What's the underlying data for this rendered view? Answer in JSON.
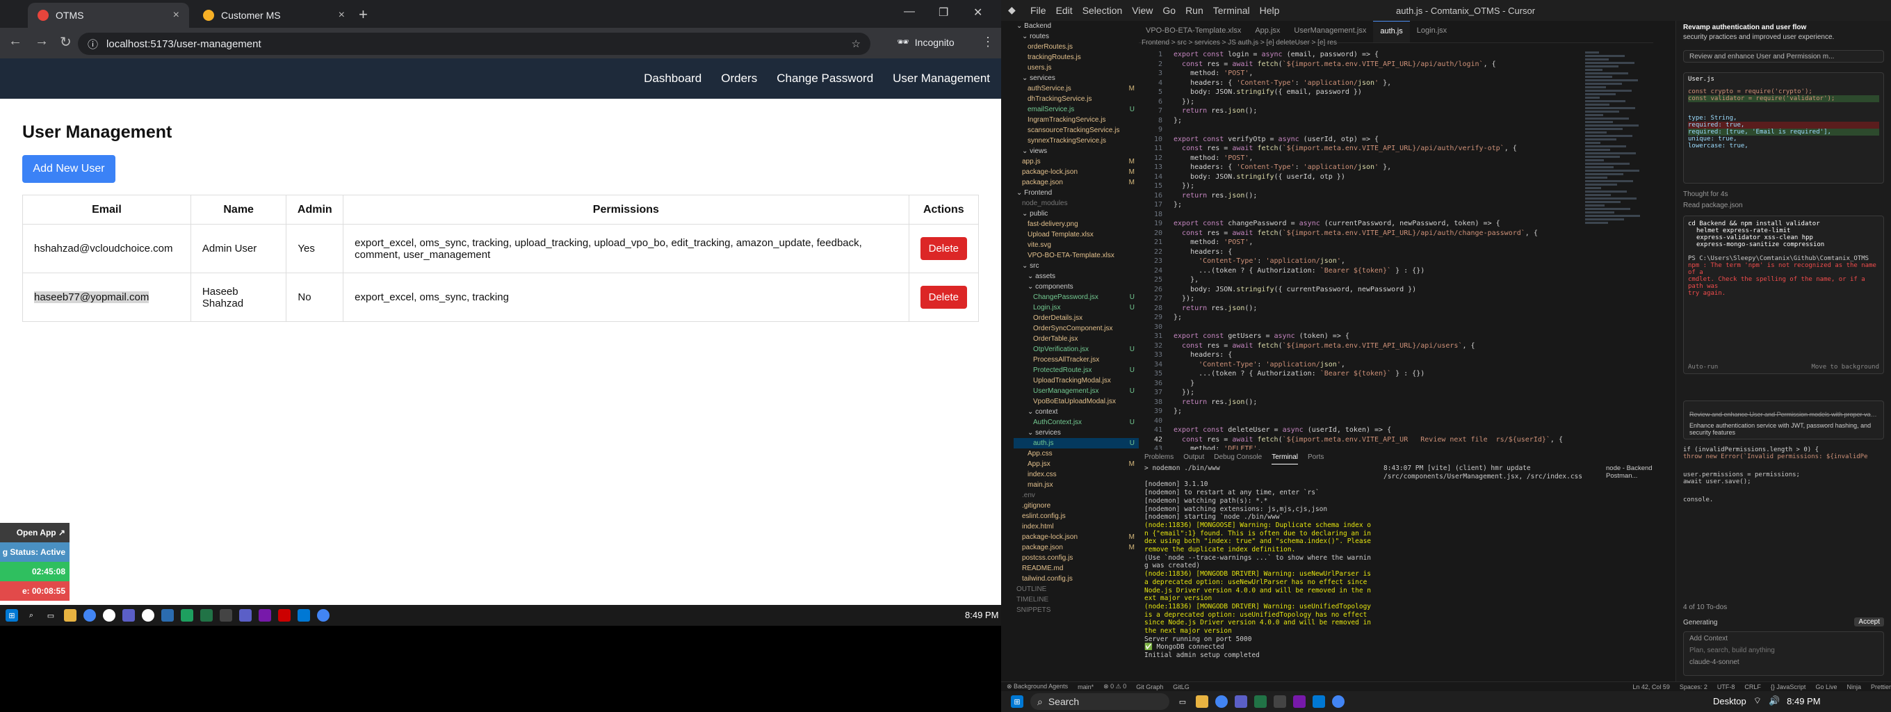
{
  "browser": {
    "tabs": [
      {
        "title": "OTMS",
        "favicon_color": "#e8453c"
      },
      {
        "title": "Customer MS",
        "favicon_color": "#f6b026"
      }
    ],
    "url": "localhost:5173/user-management",
    "incognito_label": "Incognito"
  },
  "app": {
    "nav": [
      "Dashboard",
      "Orders",
      "Change Password",
      "User Management"
    ],
    "heading": "User Management",
    "add_button": "Add New User",
    "columns": [
      "Email",
      "Name",
      "Admin",
      "Permissions",
      "Actions"
    ],
    "rows": [
      {
        "email": "hshahzad@vcloudchoice.com",
        "name": "Admin User",
        "admin": "Yes",
        "permissions": "export_excel, oms_sync, tracking, upload_tracking, upload_vpo_bo, edit_tracking, amazon_update, feedback, comment, user_management",
        "action": "Delete"
      },
      {
        "email": "haseeb77@yopmail.com",
        "name": "Haseeb Shahzad",
        "admin": "No",
        "permissions": "export_excel, oms_sync, tracking",
        "action": "Delete"
      }
    ]
  },
  "widget": {
    "open_app": "Open App ↗",
    "status": "g Status: Active",
    "time1": "02:45:08",
    "time2": "e: 00:08:55"
  },
  "taskbar_left": {
    "time": "8:49 PM"
  },
  "ide": {
    "title": "auth.js - Comtanix_OTMS - Cursor",
    "menu": [
      "File",
      "Edit",
      "Selection",
      "View",
      "Go",
      "Run",
      "Terminal",
      "Help"
    ],
    "tabs": [
      "VPO-BO-ETA-Template.xlsx",
      "App.jsx",
      "UserManagement.jsx",
      "auth.js",
      "Login.jsx"
    ],
    "breadcrumb": "Frontend > src > services > JS auth.js > [e] deleteUser > [e] res",
    "explorer": [
      {
        "t": "Backend",
        "c": "folder",
        "i": 0
      },
      {
        "t": "routes",
        "c": "folder",
        "i": 1
      },
      {
        "t": "orderRoutes.js",
        "c": "yel",
        "i": 2
      },
      {
        "t": "trackingRoutes.js",
        "c": "yel",
        "i": 2
      },
      {
        "t": "users.js",
        "c": "yel",
        "i": 2
      },
      {
        "t": "services",
        "c": "folder",
        "i": 1
      },
      {
        "t": "authService.js",
        "c": "yel",
        "i": 2,
        "b": "M"
      },
      {
        "t": "dhTrackingService.js",
        "c": "yel",
        "i": 2
      },
      {
        "t": "emailService.js",
        "c": "green",
        "i": 2,
        "b": "U"
      },
      {
        "t": "IngramTrackingService.js",
        "c": "yel",
        "i": 2
      },
      {
        "t": "scansourceTrackingService.js",
        "c": "yel",
        "i": 2
      },
      {
        "t": "synnexTrackingService.js",
        "c": "yel",
        "i": 2
      },
      {
        "t": "views",
        "c": "folder",
        "i": 1
      },
      {
        "t": "app.js",
        "c": "yel",
        "i": 1,
        "b": "M"
      },
      {
        "t": "package-lock.json",
        "c": "yel",
        "i": 1,
        "b": "M"
      },
      {
        "t": "package.json",
        "c": "yel",
        "i": 1,
        "b": "M"
      },
      {
        "t": "Frontend",
        "c": "folder",
        "i": 0
      },
      {
        "t": "node_modules",
        "c": "gray",
        "i": 1
      },
      {
        "t": "public",
        "c": "folder",
        "i": 1
      },
      {
        "t": "fast-delivery.png",
        "c": "yel",
        "i": 2
      },
      {
        "t": "Upload Template.xlsx",
        "c": "yel",
        "i": 2
      },
      {
        "t": "vite.svg",
        "c": "yel",
        "i": 2
      },
      {
        "t": "VPO-BO-ETA-Template.xlsx",
        "c": "yel",
        "i": 2
      },
      {
        "t": "src",
        "c": "folder",
        "i": 1
      },
      {
        "t": "assets",
        "c": "folder",
        "i": 2
      },
      {
        "t": "components",
        "c": "folder",
        "i": 2
      },
      {
        "t": "ChangePassword.jsx",
        "c": "green",
        "i": 3,
        "b": "U"
      },
      {
        "t": "Login.jsx",
        "c": "green",
        "i": 3,
        "b": "U"
      },
      {
        "t": "OrderDetails.jsx",
        "c": "yel",
        "i": 3
      },
      {
        "t": "OrderSyncComponent.jsx",
        "c": "yel",
        "i": 3
      },
      {
        "t": "OrderTable.jsx",
        "c": "yel",
        "i": 3
      },
      {
        "t": "OtpVerification.jsx",
        "c": "green",
        "i": 3,
        "b": "U"
      },
      {
        "t": "ProcessAllTracker.jsx",
        "c": "yel",
        "i": 3
      },
      {
        "t": "ProtectedRoute.jsx",
        "c": "green",
        "i": 3,
        "b": "U"
      },
      {
        "t": "UploadTrackingModal.jsx",
        "c": "yel",
        "i": 3
      },
      {
        "t": "UserManagement.jsx",
        "c": "green",
        "i": 3,
        "b": "U"
      },
      {
        "t": "VpoBoEtaUploadModal.jsx",
        "c": "yel",
        "i": 3
      },
      {
        "t": "context",
        "c": "folder",
        "i": 2
      },
      {
        "t": "AuthContext.jsx",
        "c": "green",
        "i": 3,
        "b": "U"
      },
      {
        "t": "services",
        "c": "folder",
        "i": 2
      },
      {
        "t": "auth.js",
        "c": "green",
        "i": 3,
        "b": "U",
        "sel": true
      },
      {
        "t": "App.css",
        "c": "yel",
        "i": 2
      },
      {
        "t": "App.jsx",
        "c": "yel",
        "i": 2,
        "b": "M"
      },
      {
        "t": "index.css",
        "c": "yel",
        "i": 2
      },
      {
        "t": "main.jsx",
        "c": "yel",
        "i": 2
      },
      {
        "t": ".env",
        "c": "gray",
        "i": 1
      },
      {
        "t": ".gitignore",
        "c": "yel",
        "i": 1
      },
      {
        "t": "eslint.config.js",
        "c": "yel",
        "i": 1
      },
      {
        "t": "index.html",
        "c": "yel",
        "i": 1
      },
      {
        "t": "package-lock.json",
        "c": "yel",
        "i": 1,
        "b": "M"
      },
      {
        "t": "package.json",
        "c": "yel",
        "i": 1,
        "b": "M"
      },
      {
        "t": "postcss.config.js",
        "c": "yel",
        "i": 1
      },
      {
        "t": "README.md",
        "c": "yel",
        "i": 1
      },
      {
        "t": "tailwind.config.js",
        "c": "yel",
        "i": 1
      },
      {
        "t": "OUTLINE",
        "c": "gray",
        "i": 0
      },
      {
        "t": "TIMELINE",
        "c": "gray",
        "i": 0
      },
      {
        "t": "SNIPPETS",
        "c": "gray",
        "i": 0
      }
    ],
    "code": [
      "export const login = async (email, password) => {",
      "  const res = await fetch(`${import.meta.env.VITE_API_URL}/api/auth/login`, {",
      "    method: 'POST',",
      "    headers: { 'Content-Type': 'application/json' },",
      "    body: JSON.stringify({ email, password })",
      "  });",
      "  return res.json();",
      "};",
      "",
      "export const verifyOtp = async (userId, otp) => {",
      "  const res = await fetch(`${import.meta.env.VITE_API_URL}/api/auth/verify-otp`, {",
      "    method: 'POST',",
      "    headers: { 'Content-Type': 'application/json' },",
      "    body: JSON.stringify({ userId, otp })",
      "  });",
      "  return res.json();",
      "};",
      "",
      "export const changePassword = async (currentPassword, newPassword, token) => {",
      "  const res = await fetch(`${import.meta.env.VITE_API_URL}/api/auth/change-password`, {",
      "    method: 'POST',",
      "    headers: {",
      "      'Content-Type': 'application/json',",
      "      ...(token ? { Authorization: `Bearer ${token}` } : {})",
      "    },",
      "    body: JSON.stringify({ currentPassword, newPassword })",
      "  });",
      "  return res.json();",
      "};",
      "",
      "export const getUsers = async (token) => {",
      "  const res = await fetch(`${import.meta.env.VITE_API_URL}/api/users`, {",
      "    headers: {",
      "      'Content-Type': 'application/json',",
      "      ...(token ? { Authorization: `Bearer ${token}` } : {})",
      "    }",
      "  });",
      "  return res.json();",
      "};",
      "",
      "export const deleteUser = async (userId, token) => {",
      "  const res = await fetch(`${import.meta.env.VITE_API_UR   Review next file  rs/${userId}`, {",
      "    method: 'DELETE',",
      "    headers: {"
    ],
    "panel_tabs": [
      "Problems",
      "Output",
      "Debug Console",
      "Terminal",
      "Ports"
    ],
    "terminal": [
      "> nodemon ./bin/www",
      "",
      "[nodemon] 3.1.10",
      "[nodemon] to restart at any time, enter `rs`",
      "[nodemon] watching path(s): *.*",
      "[nodemon] watching extensions: js,mjs,cjs,json",
      "[nodemon] starting `node ./bin/www`",
      "(node:11836) [MONGOOSE] Warning: Duplicate schema index on {\"email\":1} found. This is often due to declaring an index using both \"index: true\" and \"schema.index()\". Please remove the duplicate index definition.",
      "(Use `node --trace-warnings ...` to show where the warning was created)",
      "(node:11836) [MONGODB DRIVER] Warning: useNewUrlParser is a deprecated option: useNewUrlParser has no effect since Node.js Driver version 4.0.0 and will be removed in the next major version",
      "(node:11836) [MONGODB DRIVER] Warning: useUnifiedTopology is a deprecated option: useUnifiedTopology has no effect since Node.js Driver version 4.0.0 and will be removed in the next major version",
      "Server running on port 5000",
      "✅ MongoDB connected",
      "Initial admin setup completed"
    ],
    "terminal2": [
      "8:43:07 PM [vite] (client) hmr update /src/components/UserManagement.jsx, /src/index.css"
    ],
    "terminal_side": [
      "node - Backend",
      "Postman..."
    ],
    "agent": {
      "title": "Revamp authentication and user flow",
      "subtitle": "security practices and improved user experience.",
      "task": "Review and enhance User and Permission m...",
      "file": "User.js",
      "diff": [
        "const crypto = require('crypto');",
        "const validator = require('validator');",
        "",
        "type: String,",
        "required: true,",
        "required: [true, 'Email is required'],",
        "unique: true,",
        "lowercase: true,"
      ],
      "thought": "Thought for 4s",
      "read": "Read package.json",
      "cmd": [
        "cd Backend && npm install validator",
        "helmet express-rate-limit",
        "express-validator xss-clean hpp",
        "express-mongo-sanitize compression"
      ],
      "err": [
        "PS C:\\Users\\Sleepy\\Comtanix\\Github\\Comtanix_OTMS",
        "npm : The term 'npm' is not recognized as the name of a",
        "cmdlet. Check the spelling of the name, or if a path was",
        "try again."
      ],
      "auto_run": "Auto-run",
      "bg": "Move to background",
      "todo1": "Review and enhance User and Permission models with proper validation",
      "todo2": "Enhance authentication service with JWT, password hashing, and security features",
      "code2": [
        "if (invalidPermissions.length > 0) {",
        "  throw new Error(`Invalid permissions: ${invalidPe",
        "",
        "user.permissions = permissions;",
        "await user.save();",
        "",
        "console."
      ],
      "todos_status": "4 of 10 To-dos",
      "generating": "Generating",
      "accept": "Accept",
      "add_context": "Add Context",
      "input_placeholder": "Plan, search, build anything",
      "model": "claude-4-sonnet"
    },
    "statusbar": [
      "⊗ Background Agents",
      "main*",
      "⊗ 0 ⚠ 0",
      "Git Graph",
      "GitLG",
      "Ln 42, Col 59",
      "Spaces: 2",
      "UTF-8",
      "CRLF",
      "{} JavaScript",
      "Go Live",
      "Ninja",
      "Prettier"
    ]
  },
  "taskbar_right": {
    "search": "Search",
    "desktop": "Desktop",
    "time": "8:49 PM"
  }
}
